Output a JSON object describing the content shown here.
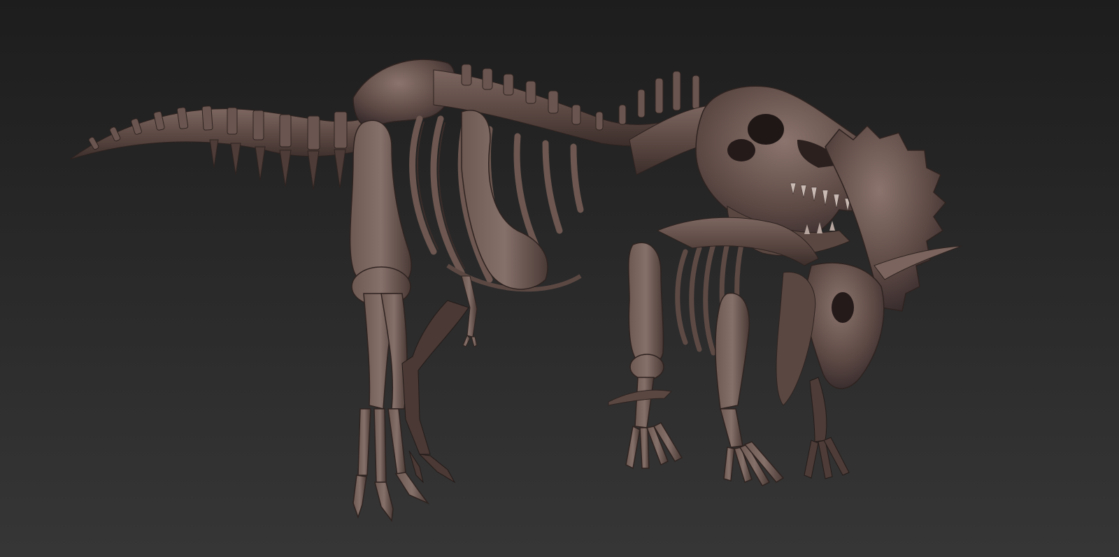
{
  "scene": {
    "subject": "trex-and-triceratops-skeleton-render",
    "material_color": "#5e4a45",
    "material_highlight": "#8a736c",
    "material_shadow": "#2e2320",
    "background_top": "#1f1f1f",
    "background_bottom": "#333333"
  },
  "icons": {
    "trex": "trex-skeleton",
    "triceratops": "triceratops-skeleton"
  }
}
